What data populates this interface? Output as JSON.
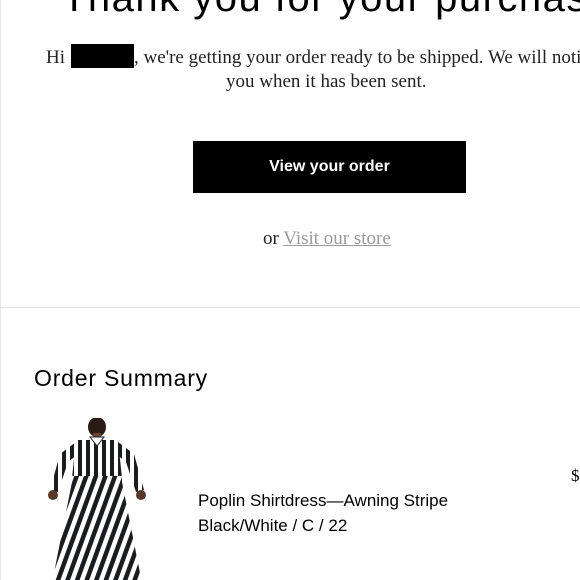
{
  "header": {
    "title": "Thank you for your purchase"
  },
  "message": {
    "greeting_prefix": "Hi",
    "line1_rest": ", we're getting your order ready to be shipped. We will notify",
    "line2": "you when it has been sent."
  },
  "actions": {
    "view_order_label": "View your order",
    "or_text": "or",
    "visit_store_label": "Visit our store"
  },
  "order_summary": {
    "title": "Order Summary",
    "items": [
      {
        "name": "Poplin Shirtdress—Awning Stripe",
        "variant": "Black/White / C / 22",
        "price": "$"
      }
    ]
  },
  "colors": {
    "button_bg": "#000000",
    "button_text": "#ffffff",
    "link": "#999999",
    "divider": "#e4e4e4"
  },
  "icons": {
    "product_image": "striped-shirtdress-photo"
  }
}
